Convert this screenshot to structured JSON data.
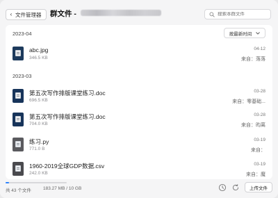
{
  "header": {
    "back_label": "文件管理器",
    "title": "群文件 -",
    "search_placeholder": "搜索本群文件"
  },
  "groups": [
    {
      "date": "2023-04",
      "sort_label": "按最新时间",
      "files": [
        {
          "name": "abc.jpg",
          "size": "346.5 KB",
          "date": "04-12",
          "from": "来自：落落",
          "icon": "image-file-icon"
        }
      ]
    },
    {
      "date": "2023-03",
      "files": [
        {
          "name": "第五次写作排版课堂练习.doc",
          "size": "696.5 KB",
          "date": "03-28",
          "from": "来自：零基础...",
          "icon": "doc-file-icon"
        },
        {
          "name": "第五次写作排版课堂练习.doc",
          "size": "704.0 KB",
          "date": "03-28",
          "from": "来自：昀离",
          "icon": "doc-file-icon"
        },
        {
          "name": "练习.py",
          "size": "771.0 B",
          "date": "03-19",
          "from": "来自：",
          "icon": "python-file-icon"
        },
        {
          "name": "1960-2019全球GDP数据.csv",
          "size": "242.0 KB",
          "date": "03-19",
          "from": "来自：魔",
          "icon": "csv-file-icon"
        }
      ]
    }
  ],
  "footer": {
    "file_count": "共 43 个文件",
    "storage": "183.27 MB / 10 GB",
    "storage_used_fraction": 0.018,
    "upload_label": "上传文件"
  },
  "colors": {
    "accent": "#2b82ff",
    "doc_icon": "#17345a",
    "image_icon": "#1d3a5c",
    "panel": "#ffffff",
    "background": "#f5f5f6"
  }
}
